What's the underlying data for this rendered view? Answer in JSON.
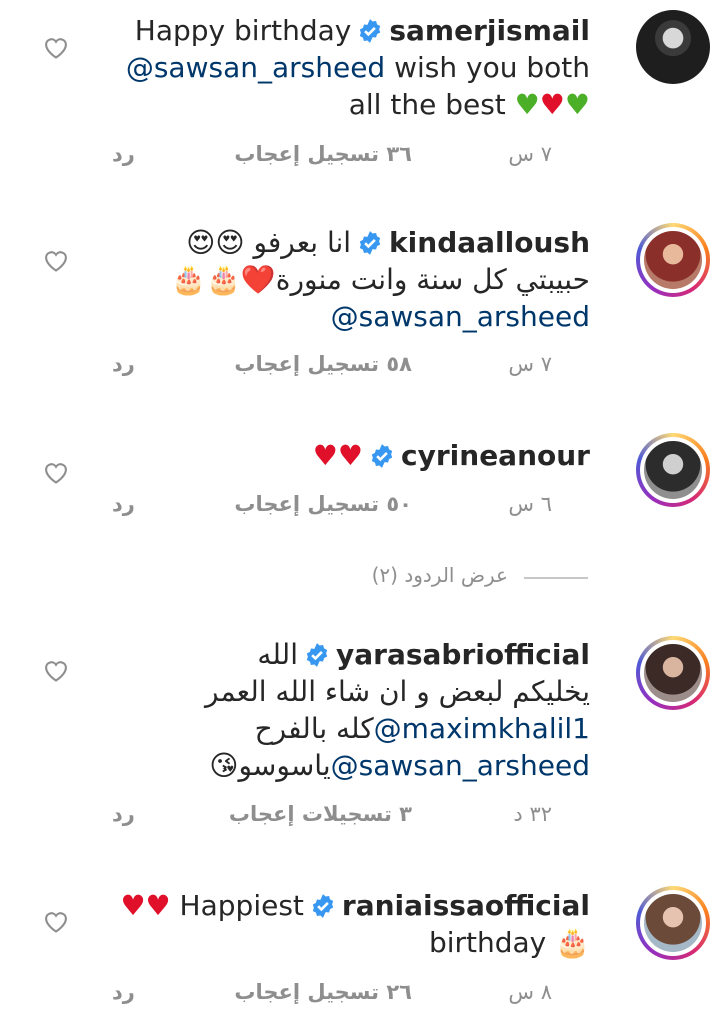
{
  "replies_toggle": "عرض الردود (٢)",
  "comments": [
    {
      "username": "samerjismail",
      "lines": [
        "Happy birthday",
        "@sawsan_arsheed wish you both",
        "all the best 💚❤️💚"
      ],
      "time": "٧ س",
      "likes": "٣٦ تسجيل إعجاب",
      "reply": "رد"
    },
    {
      "username": "kindaalloush",
      "lines": [
        "😍😍 انا بعرفو",
        "🎂🎂❤️حبيبتي كل سنة وانت منورة",
        "@sawsan_arsheed"
      ],
      "time": "٧ س",
      "likes": "٥٨ تسجيل إعجاب",
      "reply": "رد"
    },
    {
      "username": "cyrineanour",
      "lines": [
        "❤️❤️"
      ],
      "time": "٦ س",
      "likes": "٥٠ تسجيل إعجاب",
      "reply": "رد"
    },
    {
      "username": "yarasabriofficial",
      "lines": [
        "الله",
        "يخليكم لبعض و ان شاء الله العمر",
        "كله بالفرح@maximkhalil1",
        "😘ياسوسو@sawsan_arsheed"
      ],
      "time": "٣٢ د",
      "likes": "٣ تسجيلات إعجاب",
      "reply": "رد"
    },
    {
      "username": "raniaissaofficial",
      "lines": [
        "❤️❤️ Happiest",
        "birthday 🎂"
      ],
      "time": "٨ س",
      "likes": "٢٦ تسجيل إعجاب",
      "reply": "رد"
    }
  ],
  "icons": {
    "verified": "verified-badge-icon",
    "like": "heart-outline-icon",
    "avatar": "profile-avatar"
  },
  "colors": {
    "mention": "#00376b",
    "verified": "#3897f0",
    "meta": "#8e8e8e"
  }
}
